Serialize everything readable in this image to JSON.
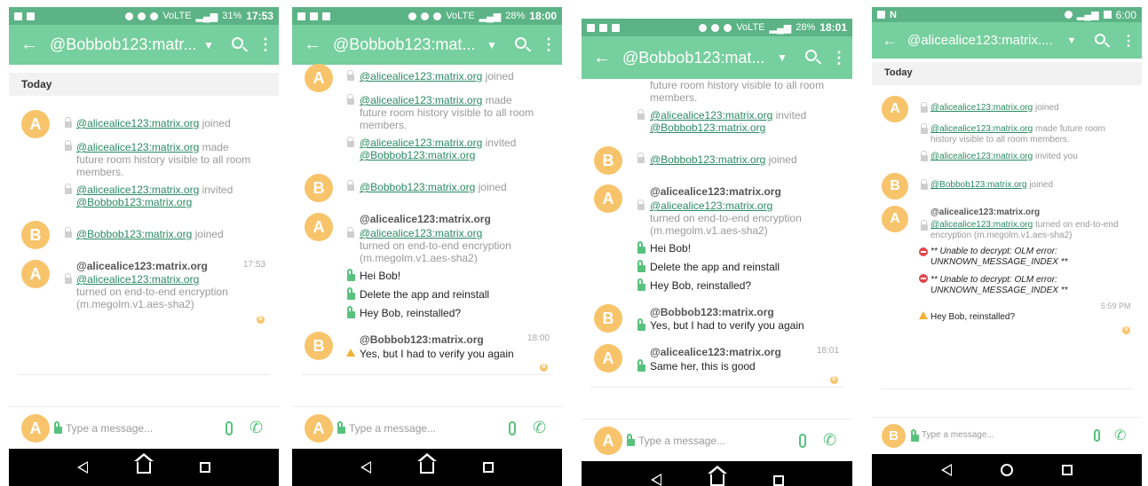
{
  "common": {
    "placeholder": "Type a message...",
    "avatar_a": "A",
    "avatar_b": "B",
    "today": "Today",
    "more_icon": "⋮",
    "back_icon": "←",
    "caret_icon": "▼"
  },
  "colors": {
    "accent": "#76cf9e",
    "avatar": "#f7c46c",
    "link": "#2a8a62",
    "lock_green": "#58c27d",
    "warning": "#f2b233",
    "error": "#e0464b"
  },
  "screens": [
    {
      "status": {
        "battery": "31%",
        "time": "17:53"
      },
      "title": "@Bobbob123:matr...",
      "events": {
        "alice_joined_user": "@alicealice123:matrix.org",
        "alice_joined_text": "joined",
        "history_user": "@alicealice123:matrix.org",
        "history_text_1": "made",
        "history_text_2": "future room history visible to all room",
        "history_text_3": "members.",
        "invite_user": "@alicealice123:matrix.org",
        "invite_text": "invited",
        "invitee": "@Bobbob123:matrix.org",
        "bob_joined_user": "@Bobbob123:matrix.org",
        "bob_joined_text": "joined"
      },
      "encryption": {
        "sender": "@alicealice123:matrix.org",
        "time": "17:53",
        "user": "@alicealice123:matrix.org",
        "text_1": "turned on end-to-end encryption",
        "text_2": "(m.megolm.v1.aes-sha2)"
      },
      "read_receipt": "B"
    },
    {
      "status": {
        "battery": "28%",
        "time": "18:00"
      },
      "title": "@Bobbob123:mat...",
      "events": {
        "alice_joined_user": "@alicealice123:matrix.org",
        "alice_joined_text": "joined",
        "history_user": "@alicealice123:matrix.org",
        "history_text_1": "made",
        "history_text_2": "future room history visible to all room",
        "history_text_3": "members.",
        "invite_user": "@alicealice123:matrix.org",
        "invite_text": "invited",
        "invitee": "@Bobbob123:matrix.org",
        "bob_joined_user": "@Bobbob123:matrix.org",
        "bob_joined_text": "joined"
      },
      "encryption": {
        "sender": "@alicealice123:matrix.org",
        "user": "@alicealice123:matrix.org",
        "text_1": "turned on end-to-end encryption",
        "text_2": "(m.megolm.v1.aes-sha2)"
      },
      "alice_messages": [
        "Hei Bob!",
        "Delete the app and reinstall",
        "Hey Bob, reinstalled?"
      ],
      "bob_sender": "@Bobbob123:matrix.org",
      "bob_time": "18:00",
      "bob_message": "Yes, but I had to verify you again",
      "read_receipt": "B"
    },
    {
      "status": {
        "battery": "28%",
        "time": "18:01"
      },
      "title": "@Bobbob123:mat...",
      "events": {
        "history_text_2": "future room history visible to all room",
        "history_text_3": "members.",
        "invite_user": "@alicealice123:matrix.org",
        "invite_text": "invited",
        "invitee": "@Bobbob123:matrix.org",
        "bob_joined_user": "@Bobbob123:matrix.org",
        "bob_joined_text": "joined"
      },
      "encryption": {
        "sender": "@alicealice123:matrix.org",
        "user": "@alicealice123:matrix.org",
        "text_1": "turned on end-to-end encryption",
        "text_2": "(m.megolm.v1.aes-sha2)"
      },
      "alice_messages": [
        "Hei Bob!",
        "Delete the app and reinstall",
        "Hey Bob, reinstalled?"
      ],
      "bob_sender": "@Bobbob123:matrix.org",
      "bob_message": "Yes, but I had to verify you again",
      "alice_sender_2": "@alicealice123:matrix.org",
      "alice_time_2": "18:01",
      "alice_message_2": "Same her, this is good",
      "read_receipt": "B"
    },
    {
      "status": {
        "time": "6:00"
      },
      "title": "@alicealice123:matrix....",
      "events": {
        "alice_joined_user": "@alicealice123:matrix.org",
        "alice_joined_text": "joined",
        "history_user": "@alicealice123:matrix.org",
        "history_text_1": "made future room",
        "history_text_2": "history visible to all room members.",
        "invite_user": "@alicealice123:matrix.org",
        "invite_text": "invited you",
        "bob_joined_user": "@Bobbob123:matrix.org",
        "bob_joined_text": "joined"
      },
      "encryption": {
        "sender": "@alicealice123:matrix.org",
        "user": "@alicealice123:matrix.org",
        "text_1": "turned on end-to-end",
        "text_2": "encryption (m.megolm.v1.aes-sha2)"
      },
      "errors": [
        {
          "line_1": "** Unable to decrypt: OLM error:",
          "line_2": "UNKNOWN_MESSAGE_INDEX **"
        },
        {
          "line_1": "** Unable to decrypt: OLM error:",
          "line_2": "UNKNOWN_MESSAGE_INDEX **"
        }
      ],
      "time": "5:59 PM",
      "warn_message": "Hey Bob, reinstalled?",
      "read_receipt": "A"
    }
  ]
}
